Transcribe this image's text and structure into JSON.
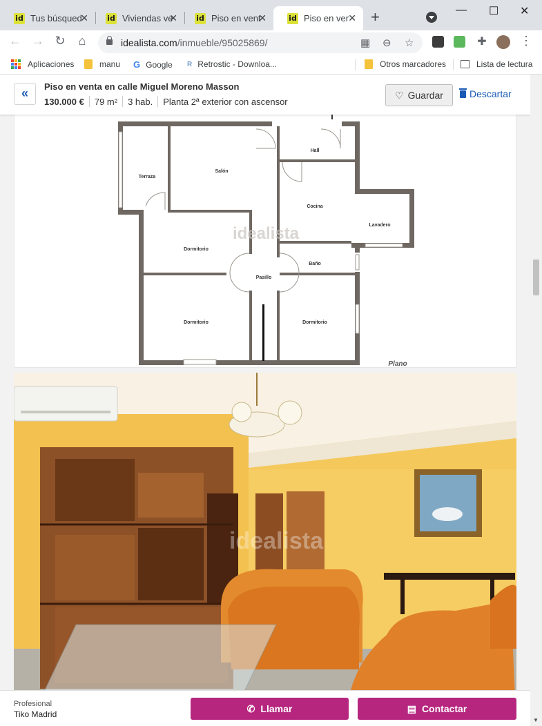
{
  "browser": {
    "tabs": [
      {
        "label": "Tus búsqued",
        "favicon": "id",
        "active": false
      },
      {
        "label": "Viviendas ve",
        "favicon": "id",
        "active": false
      },
      {
        "label": "Piso en vent",
        "favicon": "id",
        "active": false
      },
      {
        "label": "Piso en vent",
        "favicon": "id",
        "active": true
      }
    ],
    "new_tab_label": "+",
    "address": {
      "domain": "idealista.com",
      "path": "/inmueble/95025869/"
    },
    "bookmarks": [
      {
        "label": "Aplicaciones",
        "icon": "apps-grid-icon"
      },
      {
        "label": "manu",
        "icon": "folder-icon"
      },
      {
        "label": "Google",
        "icon": "google-icon"
      },
      {
        "label": "Retrostic - Downloa...",
        "icon": "retrostic-icon"
      },
      {
        "label": "Otros marcadores",
        "icon": "folder-icon"
      },
      {
        "label": "Lista de lectura",
        "icon": "reading-list-icon"
      }
    ]
  },
  "listing": {
    "title": "Piso en venta en calle Miguel Moreno Masson",
    "price": "130.000 €",
    "area": "79 m²",
    "rooms": "3 hab.",
    "floor": "Planta 2ª exterior con ascensor",
    "save_label": "Guardar",
    "discard_label": "Descartar"
  },
  "floorplan": {
    "watermark": "idealista",
    "caption": "Plano",
    "rooms": {
      "hall": "Hall",
      "terraza": "Terraza",
      "salon": "Salón",
      "cocina": "Cocina",
      "lavadero": "Lavadero",
      "dormitorio_1": "Dormitorio",
      "pasillo": "Pasillo",
      "bano": "Baño",
      "dormitorio_2": "Dormitorio",
      "dormitorio_3": "Dormitorio"
    }
  },
  "photo": {
    "watermark": "idealista"
  },
  "contact": {
    "type_label": "Profesional",
    "name": "Tiko Madrid",
    "call_label": "Llamar",
    "contact_label": "Contactar"
  },
  "colors": {
    "accent": "#b6267f",
    "link": "#1a5ab5",
    "brand_favicon": "#dce23a",
    "wall": "#6f6862"
  }
}
